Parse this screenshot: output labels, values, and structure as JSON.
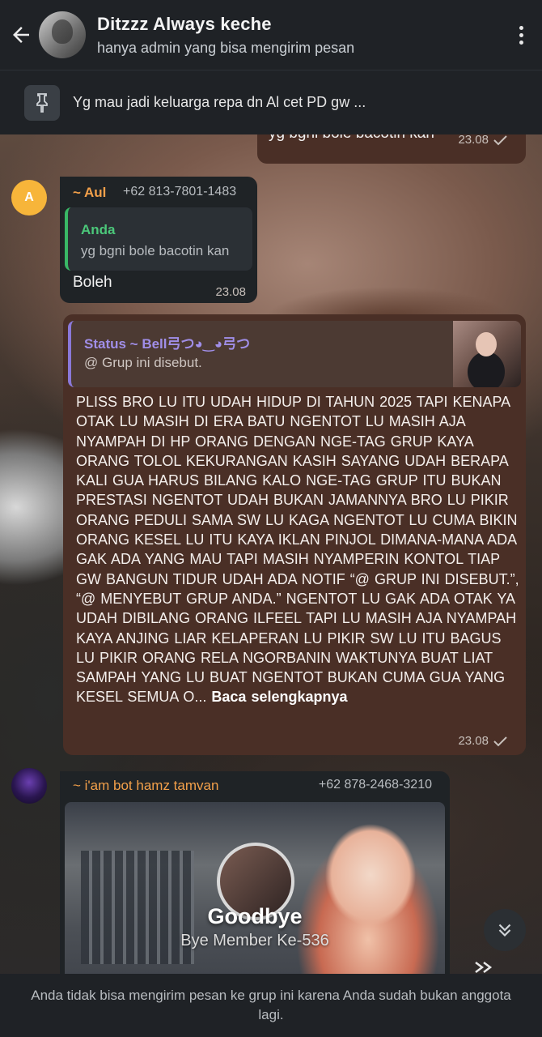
{
  "header": {
    "title": "Ditzzz  Always keche",
    "subtitle": "hanya admin yang bisa mengirim pesan"
  },
  "pinned": {
    "text": "Yg mau jadi keluarga repa dn Al cet PD gw ..."
  },
  "messages": {
    "m1": {
      "text": "yg bgni bole bacotin kan",
      "time": "23.08"
    },
    "m2": {
      "avatar_letter": "A",
      "sender": "~ Aul",
      "phone": "+62 813-7801-1483",
      "quote_name": "Anda",
      "quote_text": "yg bgni bole bacotin kan",
      "text": "Boleh",
      "time": "23.08"
    },
    "m3": {
      "quote_name": "Status ~ Bell⼸つ◕‿◕⼸つ",
      "quote_text": "@ Grup ini disebut.",
      "text": "PLISS BRO LU ITU UDAH HIDUP DI TAHUN 2025 TAPI KENAPA OTAK LU MASIH DI ERA BATU NGENTOT LU MASIH AJA NYAMPAH DI HP ORANG DENGAN NGE-TAG GRUP KAYA ORANG TOLOL KEKURANGAN KASIH SAYANG UDAH BERAPA KALI GUA HARUS BILANG KALO NGE-TAG GRUP ITU BUKAN PRESTASI NGENTOT UDAH BUKAN JAMANNYA BRO LU PIKIR ORANG PEDULI SAMA SW LU KAGA NGENTOT LU CUMA BIKIN ORANG KESEL LU ITU KAYA IKLAN PINJOL DIMANA-MANA ADA GAK ADA YANG MAU TAPI MASIH NYAMPERIN KONTOL TIAP GW BANGUN TIDUR UDAH ADA NOTIF “@ GRUP INI DISEBUT.”, “@ MENYEBUT GRUP ANDA.” NGENTOT LU GAK ADA OTAK YA UDAH DIBILANG ORANG ILFEEL TAPI LU MASIH AJA NYAMPAH KAYA ANJING LIAR KELAPERAN LU PIKIR SW LU ITU BAGUS LU PIKIR ORANG RELA NGORBANIN WAKTUNYA BUAT LIAT SAMPAH YANG LU BUAT NGENTOT BUKAN CUMA GUA YANG KESEL SEMUA O...",
      "more": "Baca selengkapnya",
      "time": "23.08"
    },
    "m4": {
      "sender": "~ i'am bot hamz tamvan",
      "phone": "+62 878-2468-3210",
      "image_title": "Goodbye",
      "image_subtitle": "Bye Member Ke-536"
    }
  },
  "footer": {
    "text": "Anda tidak bisa mengirim pesan ke grup ini karena Anda sudah bukan anggota lagi."
  },
  "icons": {
    "back": "arrow-left-icon",
    "menu": "kebab-menu-icon",
    "pin": "pin-icon",
    "read": "check-icon",
    "scroll": "double-chevron-down-icon"
  },
  "colors": {
    "header_bg": "#1f2226",
    "outgoing_bubble": "#4a2f26",
    "incoming_bubble": "#1f2326",
    "sender_orange": "#f3a04a",
    "quote_green": "#4bc77a",
    "quote_purple": "#a08ee8"
  }
}
